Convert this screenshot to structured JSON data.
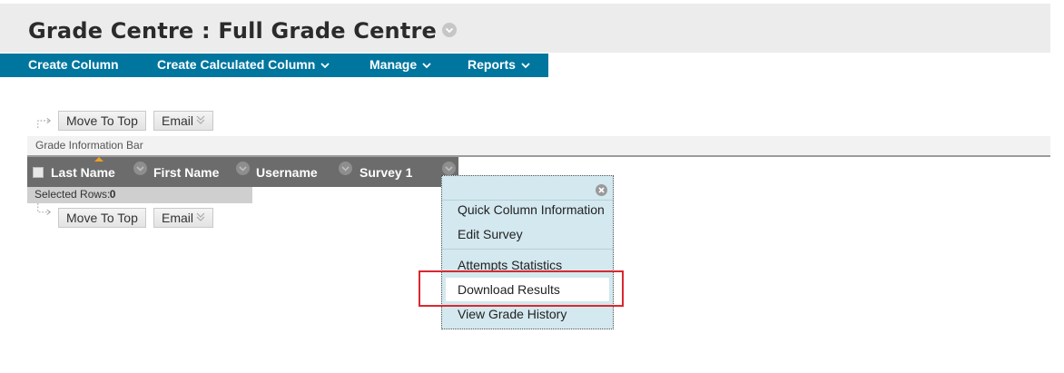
{
  "header": {
    "title": "Grade Centre : Full Grade Centre"
  },
  "actionbar": {
    "items": [
      {
        "label": "Create Column",
        "has_menu": false
      },
      {
        "label": "Create Calculated Column",
        "has_menu": true
      },
      {
        "label": "Manage",
        "has_menu": true
      },
      {
        "label": "Reports",
        "has_menu": true
      }
    ]
  },
  "top_buttons": {
    "move_to_top": "Move To Top",
    "email": "Email"
  },
  "info_bar": {
    "label": "Grade Information Bar"
  },
  "table": {
    "columns": [
      "Last Name",
      "First Name",
      "Username",
      "Survey 1"
    ]
  },
  "selected_rows": {
    "label": "Selected Rows:",
    "count": "0"
  },
  "bottom_buttons": {
    "move_to_top": "Move To Top",
    "email": "Email"
  },
  "context_menu": {
    "items": [
      "Quick Column Information",
      "Edit Survey",
      "Attempts Statistics",
      "Download Results",
      "View Grade History"
    ],
    "highlighted": "Download Results"
  },
  "colors": {
    "action_bar": "#00769f",
    "menu_bg": "#d3e8ef",
    "highlight_box": "#d9282f",
    "header_bg": "#ececec"
  }
}
